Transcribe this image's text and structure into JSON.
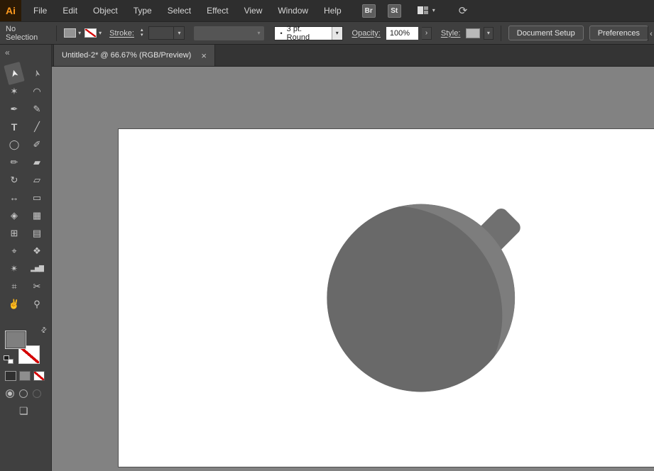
{
  "colors": {
    "menubar_bg": "#2e2e2e",
    "controlbar_bg": "#3f3f3f",
    "toolbar_bg": "#404040",
    "canvas_bg": "#828282",
    "artboard_bg": "#ffffff",
    "accent_orange": "#ff9a1e",
    "stroke_none_red": "#d40000",
    "bomb_body_dark": "#696969",
    "bomb_body_light": "#7d7d7d",
    "bomb_cap": "#707070"
  },
  "icons": {
    "caret_down": "▾",
    "caret_up": "▴",
    "chevron_right": "›",
    "chevron_left": "‹",
    "sync": "⟳",
    "swap": "⇄",
    "screen_mode": "❏",
    "collapse": "«",
    "close": "×"
  },
  "menubar": {
    "logo_text": "Ai",
    "items": [
      "File",
      "Edit",
      "Object",
      "Type",
      "Select",
      "Effect",
      "View",
      "Window",
      "Help"
    ],
    "bridge_label": "Br",
    "stock_label": "St"
  },
  "controlbar": {
    "selection_status": "No Selection",
    "stroke_label": "Stroke:",
    "brush_dot": "•",
    "brush_value": "3 pt. Round",
    "opacity_label": "Opacity:",
    "opacity_value": "100%",
    "style_label": "Style:",
    "document_setup_label": "Document Setup",
    "preferences_label": "Preferences"
  },
  "tabbar": {
    "tab_title": "Untitled-2* @ 66.67% (RGB/Preview)"
  },
  "toolbar": {
    "tools": [
      {
        "name": "selection",
        "glyph": "➤"
      },
      {
        "name": "direct-selection",
        "glyph": "➢"
      },
      {
        "name": "magic-wand",
        "glyph": "✶"
      },
      {
        "name": "lasso",
        "glyph": "◠"
      },
      {
        "name": "pen",
        "glyph": "✒"
      },
      {
        "name": "curvature",
        "glyph": "✎"
      },
      {
        "name": "type",
        "glyph": "T"
      },
      {
        "name": "line-segment",
        "glyph": "╱"
      },
      {
        "name": "ellipse",
        "glyph": "◯"
      },
      {
        "name": "paintbrush",
        "glyph": "✐"
      },
      {
        "name": "pencil",
        "glyph": "✏"
      },
      {
        "name": "eraser",
        "glyph": "▰"
      },
      {
        "name": "rotate",
        "glyph": "↻"
      },
      {
        "name": "scale",
        "glyph": "▱"
      },
      {
        "name": "width",
        "glyph": "↔"
      },
      {
        "name": "free-transform",
        "glyph": "▭"
      },
      {
        "name": "shape-builder",
        "glyph": "◈"
      },
      {
        "name": "perspective-grid",
        "glyph": "▦"
      },
      {
        "name": "mesh",
        "glyph": "⊞"
      },
      {
        "name": "gradient",
        "glyph": "▤"
      },
      {
        "name": "eyedropper",
        "glyph": "⌖"
      },
      {
        "name": "blend",
        "glyph": "❖"
      },
      {
        "name": "symbol-sprayer",
        "glyph": "✴"
      },
      {
        "name": "column-graph",
        "glyph": "▂▅▇"
      },
      {
        "name": "artboard",
        "glyph": "⌗"
      },
      {
        "name": "slice",
        "glyph": "✂"
      },
      {
        "name": "hand",
        "glyph": "✌"
      },
      {
        "name": "zoom",
        "glyph": "⚲"
      }
    ]
  }
}
